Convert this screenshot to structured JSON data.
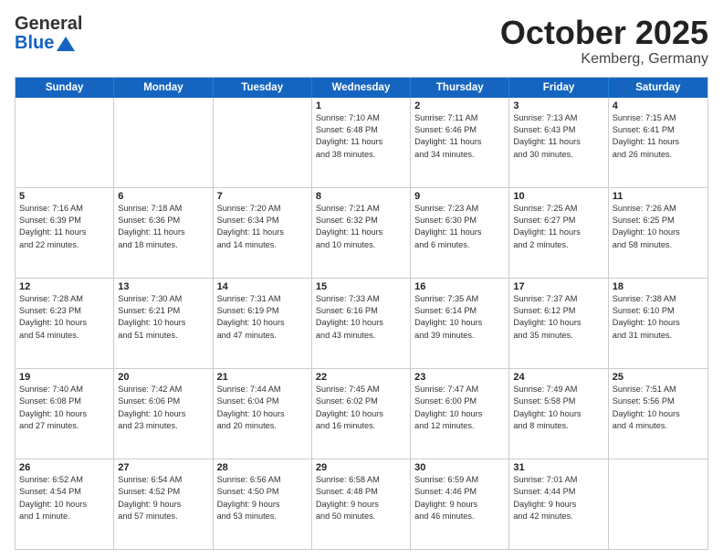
{
  "header": {
    "logo_general": "General",
    "logo_blue": "Blue",
    "title": "October 2025",
    "subtitle": "Kemberg, Germany"
  },
  "days_of_week": [
    "Sunday",
    "Monday",
    "Tuesday",
    "Wednesday",
    "Thursday",
    "Friday",
    "Saturday"
  ],
  "weeks": [
    [
      {
        "day": "",
        "info": ""
      },
      {
        "day": "",
        "info": ""
      },
      {
        "day": "",
        "info": ""
      },
      {
        "day": "1",
        "info": "Sunrise: 7:10 AM\nSunset: 6:48 PM\nDaylight: 11 hours\nand 38 minutes."
      },
      {
        "day": "2",
        "info": "Sunrise: 7:11 AM\nSunset: 6:46 PM\nDaylight: 11 hours\nand 34 minutes."
      },
      {
        "day": "3",
        "info": "Sunrise: 7:13 AM\nSunset: 6:43 PM\nDaylight: 11 hours\nand 30 minutes."
      },
      {
        "day": "4",
        "info": "Sunrise: 7:15 AM\nSunset: 6:41 PM\nDaylight: 11 hours\nand 26 minutes."
      }
    ],
    [
      {
        "day": "5",
        "info": "Sunrise: 7:16 AM\nSunset: 6:39 PM\nDaylight: 11 hours\nand 22 minutes."
      },
      {
        "day": "6",
        "info": "Sunrise: 7:18 AM\nSunset: 6:36 PM\nDaylight: 11 hours\nand 18 minutes."
      },
      {
        "day": "7",
        "info": "Sunrise: 7:20 AM\nSunset: 6:34 PM\nDaylight: 11 hours\nand 14 minutes."
      },
      {
        "day": "8",
        "info": "Sunrise: 7:21 AM\nSunset: 6:32 PM\nDaylight: 11 hours\nand 10 minutes."
      },
      {
        "day": "9",
        "info": "Sunrise: 7:23 AM\nSunset: 6:30 PM\nDaylight: 11 hours\nand 6 minutes."
      },
      {
        "day": "10",
        "info": "Sunrise: 7:25 AM\nSunset: 6:27 PM\nDaylight: 11 hours\nand 2 minutes."
      },
      {
        "day": "11",
        "info": "Sunrise: 7:26 AM\nSunset: 6:25 PM\nDaylight: 10 hours\nand 58 minutes."
      }
    ],
    [
      {
        "day": "12",
        "info": "Sunrise: 7:28 AM\nSunset: 6:23 PM\nDaylight: 10 hours\nand 54 minutes."
      },
      {
        "day": "13",
        "info": "Sunrise: 7:30 AM\nSunset: 6:21 PM\nDaylight: 10 hours\nand 51 minutes."
      },
      {
        "day": "14",
        "info": "Sunrise: 7:31 AM\nSunset: 6:19 PM\nDaylight: 10 hours\nand 47 minutes."
      },
      {
        "day": "15",
        "info": "Sunrise: 7:33 AM\nSunset: 6:16 PM\nDaylight: 10 hours\nand 43 minutes."
      },
      {
        "day": "16",
        "info": "Sunrise: 7:35 AM\nSunset: 6:14 PM\nDaylight: 10 hours\nand 39 minutes."
      },
      {
        "day": "17",
        "info": "Sunrise: 7:37 AM\nSunset: 6:12 PM\nDaylight: 10 hours\nand 35 minutes."
      },
      {
        "day": "18",
        "info": "Sunrise: 7:38 AM\nSunset: 6:10 PM\nDaylight: 10 hours\nand 31 minutes."
      }
    ],
    [
      {
        "day": "19",
        "info": "Sunrise: 7:40 AM\nSunset: 6:08 PM\nDaylight: 10 hours\nand 27 minutes."
      },
      {
        "day": "20",
        "info": "Sunrise: 7:42 AM\nSunset: 6:06 PM\nDaylight: 10 hours\nand 23 minutes."
      },
      {
        "day": "21",
        "info": "Sunrise: 7:44 AM\nSunset: 6:04 PM\nDaylight: 10 hours\nand 20 minutes."
      },
      {
        "day": "22",
        "info": "Sunrise: 7:45 AM\nSunset: 6:02 PM\nDaylight: 10 hours\nand 16 minutes."
      },
      {
        "day": "23",
        "info": "Sunrise: 7:47 AM\nSunset: 6:00 PM\nDaylight: 10 hours\nand 12 minutes."
      },
      {
        "day": "24",
        "info": "Sunrise: 7:49 AM\nSunset: 5:58 PM\nDaylight: 10 hours\nand 8 minutes."
      },
      {
        "day": "25",
        "info": "Sunrise: 7:51 AM\nSunset: 5:56 PM\nDaylight: 10 hours\nand 4 minutes."
      }
    ],
    [
      {
        "day": "26",
        "info": "Sunrise: 6:52 AM\nSunset: 4:54 PM\nDaylight: 10 hours\nand 1 minute."
      },
      {
        "day": "27",
        "info": "Sunrise: 6:54 AM\nSunset: 4:52 PM\nDaylight: 9 hours\nand 57 minutes."
      },
      {
        "day": "28",
        "info": "Sunrise: 6:56 AM\nSunset: 4:50 PM\nDaylight: 9 hours\nand 53 minutes."
      },
      {
        "day": "29",
        "info": "Sunrise: 6:58 AM\nSunset: 4:48 PM\nDaylight: 9 hours\nand 50 minutes."
      },
      {
        "day": "30",
        "info": "Sunrise: 6:59 AM\nSunset: 4:46 PM\nDaylight: 9 hours\nand 46 minutes."
      },
      {
        "day": "31",
        "info": "Sunrise: 7:01 AM\nSunset: 4:44 PM\nDaylight: 9 hours\nand 42 minutes."
      },
      {
        "day": "",
        "info": ""
      }
    ]
  ]
}
